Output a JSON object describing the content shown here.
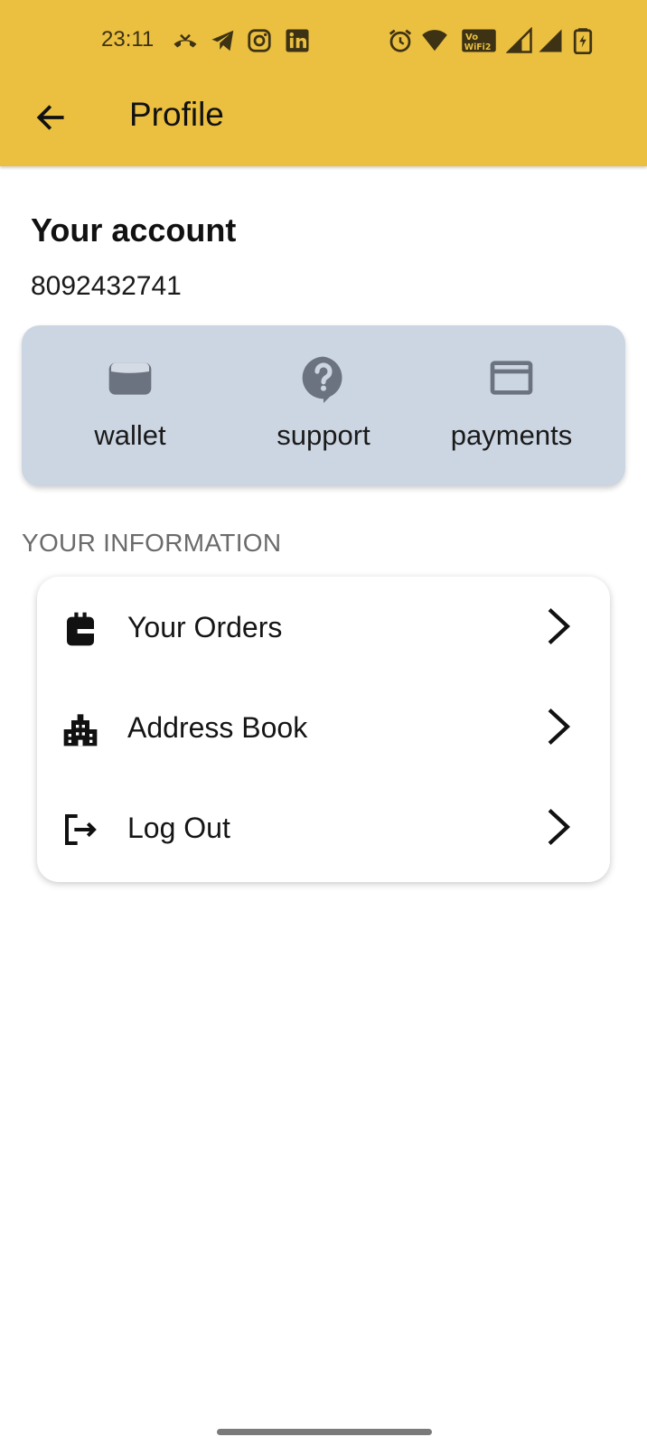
{
  "colors": {
    "appbar": "#ebbf40",
    "quick_card": "#ccd5e2",
    "quick_icon": "#6b7280"
  },
  "status_bar": {
    "time": "23:11",
    "icons": [
      "missed-call-icon",
      "telegram-icon",
      "instagram-icon",
      "linkedin-icon",
      "alarm-icon",
      "wifi-icon",
      "vowifi-icon",
      "signal-icon",
      "signal-icon",
      "battery-icon"
    ]
  },
  "appbar": {
    "back_icon": "arrow-left-icon",
    "title": "Profile"
  },
  "account": {
    "heading": "Your account",
    "phone": "8092432741"
  },
  "quick_actions": [
    {
      "label": "wallet",
      "icon": "wallet-icon"
    },
    {
      "label": "support",
      "icon": "help-icon"
    },
    {
      "label": "payments",
      "icon": "credit-card-icon"
    }
  ],
  "info": {
    "heading": "YOUR INFORMATION",
    "items": [
      {
        "label": "Your Orders",
        "icon": "shopping-bag-icon"
      },
      {
        "label": "Address Book",
        "icon": "building-icon"
      },
      {
        "label": "Log Out",
        "icon": "logout-icon"
      }
    ]
  }
}
